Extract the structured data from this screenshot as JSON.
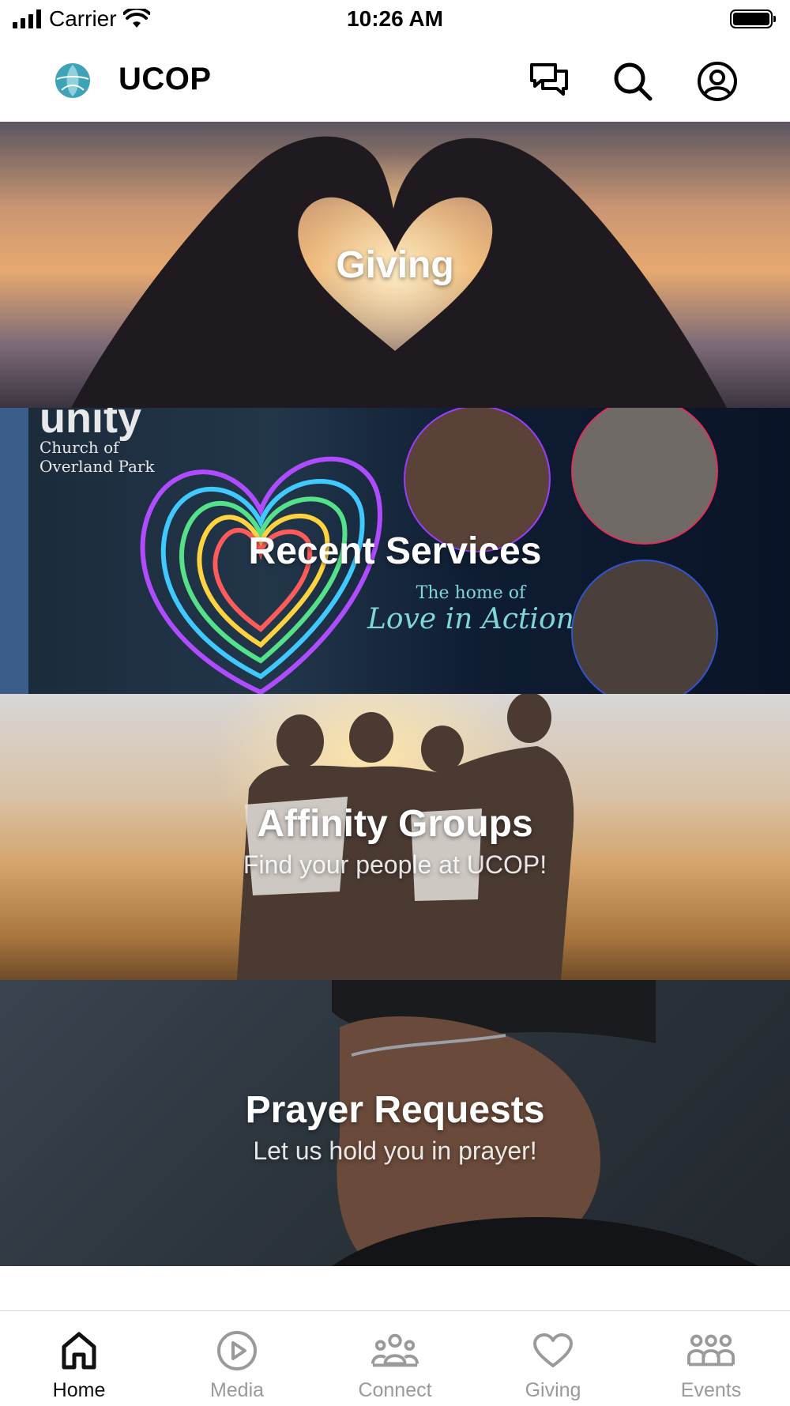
{
  "status_bar": {
    "carrier": "Carrier",
    "time": "10:26 AM"
  },
  "header": {
    "title": "UCOP",
    "icons": [
      "chat-icon",
      "search-icon",
      "profile-icon"
    ]
  },
  "cards": [
    {
      "title": "Giving",
      "subtitle": ""
    },
    {
      "title": "Recent Services",
      "subtitle": "",
      "banner_text": {
        "line1": "unity",
        "line2": "Church of",
        "line3": "Overland Park",
        "tagline1": "The home of",
        "tagline2": "Love in Action"
      }
    },
    {
      "title": "Affinity Groups",
      "subtitle": "Find your people at UCOP!"
    },
    {
      "title": "Prayer Requests",
      "subtitle": "Let us hold you in prayer!"
    }
  ],
  "tab_bar": {
    "active": "Home",
    "tabs": [
      {
        "label": "Home",
        "icon": "home-icon"
      },
      {
        "label": "Media",
        "icon": "play-icon"
      },
      {
        "label": "Connect",
        "icon": "people-icon"
      },
      {
        "label": "Giving",
        "icon": "heart-icon"
      },
      {
        "label": "Events",
        "icon": "group-icon"
      }
    ]
  },
  "colors": {
    "accent_active": "#111111",
    "inactive": "#9a9a9a",
    "logo_teal": "#3fa3b8"
  }
}
